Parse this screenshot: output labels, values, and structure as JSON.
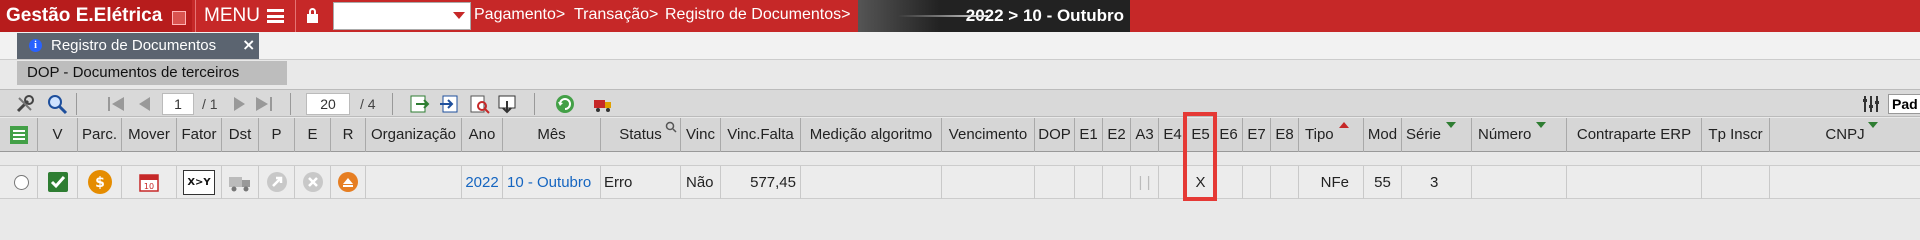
{
  "app": {
    "brand": "Gestão E.Elétrica",
    "menu_label": "MENU"
  },
  "breadcrumb": [
    {
      "label": "Pagamento>"
    },
    {
      "label": "Transação>"
    },
    {
      "label": "Registro de Documentos>"
    }
  ],
  "period": "2022 > 10 - Outubro",
  "tab": {
    "label": "Registro de Documentos",
    "close": "×"
  },
  "subtab": {
    "label": "DOP - Documentos de terceiros"
  },
  "toolbar": {
    "page_current": "1",
    "page_total": "/ 1",
    "page_size": "20",
    "page_size_total": "/ 4",
    "view_label": "Pad"
  },
  "grid": {
    "columns": [
      "",
      "V",
      "Parc.",
      "Mover",
      "Fator",
      "Dst",
      "P",
      "E",
      "R",
      "Organização",
      "Ano",
      "Mês",
      "Status",
      "Vinc",
      "Vinc.Falta",
      "Medição algoritmo",
      "Vencimento",
      "DOP",
      "E1",
      "E2",
      "A3",
      "E4",
      "E5",
      "E6",
      "E7",
      "E8",
      "Tipo",
      "Mod",
      "Série",
      "Número",
      "Contraparte ERP",
      "Tp Inscr",
      "CNPJ"
    ],
    "row": {
      "ano": "2022",
      "mes": "10 - Outubro",
      "status": "Erro",
      "vinc": "Não",
      "vinc_falta": "577,45",
      "a3": "| |",
      "e5": "X",
      "tipo": "NFe",
      "mod": "55",
      "serie": "3",
      "fator_icon": "X>Y"
    }
  },
  "colors": {
    "brand_red": "#c62828",
    "highlight": "#e53935",
    "link": "#1565c0"
  }
}
